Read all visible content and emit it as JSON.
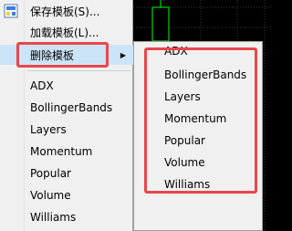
{
  "menu": {
    "save_template": "保存模板(S)...",
    "load_template": "加载模板(L)...",
    "delete_template": "删除模板",
    "templates": [
      "ADX",
      "BollingerBands",
      "Layers",
      "Momentum",
      "Popular",
      "Volume",
      "Williams"
    ]
  },
  "submenu": {
    "items": [
      "ADX",
      "BollingerBands",
      "Layers",
      "Momentum",
      "Popular",
      "Volume",
      "Williams"
    ]
  },
  "colors": {
    "highlight": "#cce4f7",
    "annotation_red": "#e8474b",
    "candle_green": "#00ff00"
  }
}
